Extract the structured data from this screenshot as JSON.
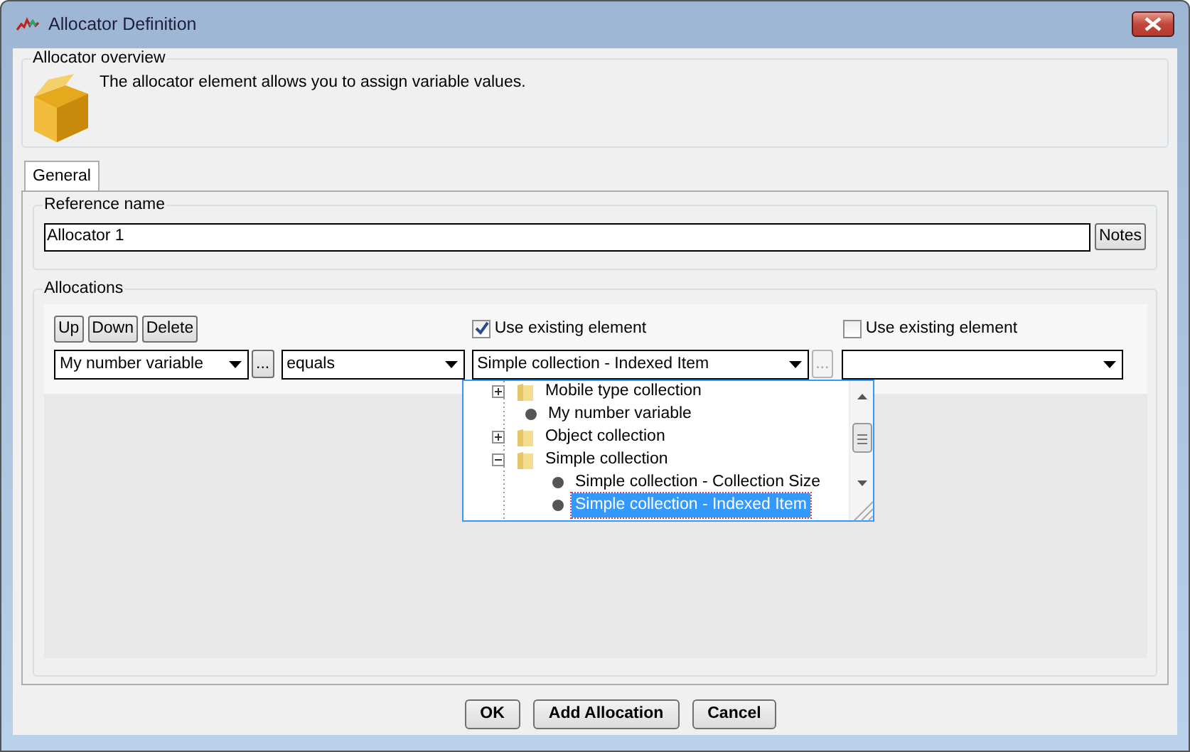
{
  "window": {
    "title": "Allocator Definition"
  },
  "overview": {
    "title": "Allocator overview",
    "description": "The allocator element allows you to assign variable values."
  },
  "tabs": [
    {
      "label": "General",
      "selected": true
    }
  ],
  "reference": {
    "title": "Reference name",
    "value": "Allocator 1",
    "notes_button": "Notes"
  },
  "allocations": {
    "title": "Allocations",
    "toolbar": [
      "Up",
      "Down",
      "Delete"
    ],
    "checkboxes": [
      {
        "label": "Use existing element",
        "checked": true
      },
      {
        "label": "Use existing element",
        "checked": false
      }
    ],
    "variable": {
      "value": "My number variable",
      "browse": "...",
      "browse_disabled": false
    },
    "operator": {
      "value": "equals"
    },
    "target": {
      "value": "Simple collection - Indexed Item",
      "browse": "...",
      "browse_disabled": true,
      "expanded": true
    },
    "dropdown": [
      {
        "label": "Mobile type collection",
        "kind": "folder",
        "expanded": false,
        "selected": false
      },
      {
        "label": "My number variable",
        "kind": "leaf",
        "selected": false
      },
      {
        "label": "Object collection",
        "kind": "folder",
        "expanded": false,
        "selected": false
      },
      {
        "label": "Simple collection",
        "kind": "folder",
        "expanded": true,
        "selected": false,
        "children": [
          {
            "label": "Simple collection - Collection Size",
            "kind": "leaf",
            "selected": false
          },
          {
            "label": "Simple collection - Indexed Item",
            "kind": "leaf",
            "selected": true
          }
        ]
      }
    ]
  },
  "buttons": [
    "OK",
    "Add Allocation",
    "Cancel"
  ]
}
